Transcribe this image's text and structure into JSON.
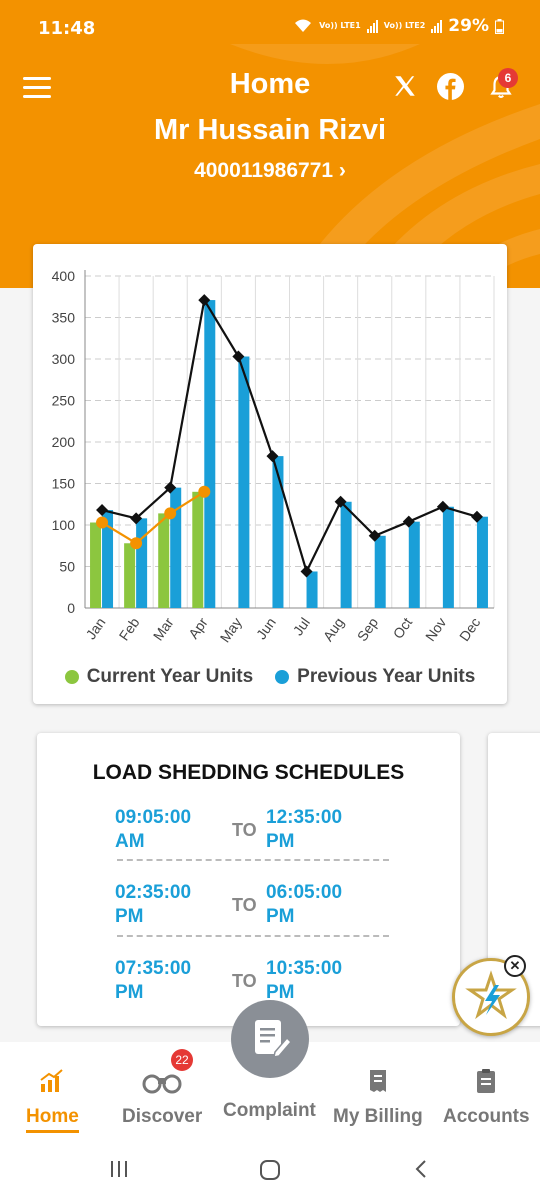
{
  "status_bar": {
    "time": "11:48",
    "net1": "Vo)) LTE1",
    "net2": "Vo)) LTE2",
    "battery": "29%"
  },
  "header": {
    "title": "Home",
    "name": "Mr Hussain Rizvi",
    "account": "400011986771 ›",
    "notification_count": "6"
  },
  "chart_data": {
    "type": "bar",
    "categories": [
      "Jan",
      "Feb",
      "Mar",
      "Apr",
      "May",
      "Jun",
      "Jul",
      "Aug",
      "Sep",
      "Oct",
      "Nov",
      "Dec"
    ],
    "series": [
      {
        "name": "Current Year Units",
        "color": "#8cc63f",
        "values": [
          103,
          78,
          114,
          140,
          null,
          null,
          null,
          null,
          null,
          null,
          null,
          null
        ]
      },
      {
        "name": "Previous Year Units",
        "color": "#1a9fd8",
        "values": [
          118,
          108,
          145,
          371,
          303,
          183,
          44,
          128,
          87,
          104,
          122,
          110
        ]
      }
    ],
    "line_series": [
      {
        "of": "Current Year Units",
        "color": "#f39200",
        "values": [
          103,
          78,
          114,
          140
        ]
      },
      {
        "of": "Previous Year Units",
        "color": "#111111",
        "values": [
          118,
          108,
          145,
          371,
          303,
          183,
          44,
          128,
          87,
          104,
          122,
          110
        ]
      }
    ],
    "ylim": [
      0,
      400
    ],
    "yticks": [
      "0",
      "50",
      "100",
      "150",
      "200",
      "250",
      "300",
      "350",
      "400"
    ],
    "grid": true,
    "legend_position": "bottom"
  },
  "load_shedding": {
    "title": "LOAD SHEDDING SCHEDULES",
    "to_label": "TO",
    "rows": [
      {
        "from": "09:05:00 AM",
        "to": "12:35:00 PM"
      },
      {
        "from": "02:35:00 PM",
        "to": "06:05:00 PM"
      },
      {
        "from": "07:35:00 PM",
        "to": "10:35:00 PM"
      }
    ]
  },
  "bottom_nav": {
    "home": "Home",
    "discover": "Discover",
    "discover_badge": "22",
    "complaint": "Complaint",
    "billing": "My Billing",
    "accounts": "Accounts"
  },
  "colors": {
    "brand": "#f39200",
    "accent_blue": "#1a9fd8",
    "accent_green": "#8cc63f"
  }
}
